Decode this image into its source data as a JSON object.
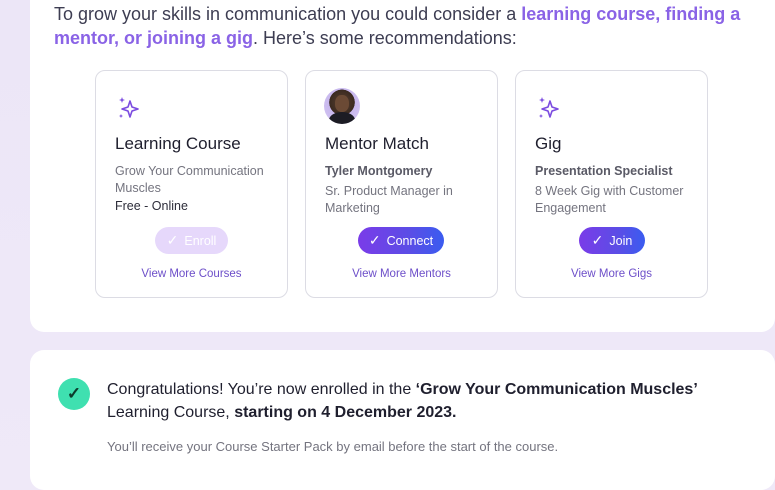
{
  "intro": {
    "text_before": "To grow your skills in communication you could consider a ",
    "highlight": "learning course, finding a mentor, or joining a gig",
    "text_after": ". Here’s some recommendations:"
  },
  "cards": [
    {
      "icon": "sparkle-icon",
      "title": "Learning Course",
      "subtitle": "Grow Your Communication Muscles",
      "detail": "Free - Online",
      "button_label": "Enroll",
      "button_state": "disabled",
      "link": "View More Courses"
    },
    {
      "icon": "avatar",
      "title": "Mentor Match",
      "subtitle": "Tyler Montgomery",
      "detail": "Sr. Product Manager in Marketing",
      "button_label": "Connect",
      "link": "View More Mentors"
    },
    {
      "icon": "sparkle-icon",
      "title": "Gig",
      "subtitle": "Presentation Specialist",
      "detail": "8 Week Gig with Customer Engagement",
      "button_label": "Join",
      "link": "View More Gigs"
    }
  ],
  "confirmation": {
    "line_before": "Congratulations! You’re now enrolled in the ",
    "course_name": "‘Grow Your Communication Muscles’",
    "line_middle": " Learning Course, ",
    "start_text": "starting on 4 December 2023.",
    "note": "You’ll receive your Course Starter Pack by email before the start of the course."
  },
  "colors": {
    "accent": "#8a63e6",
    "button_gradient_start": "#7a3ce8",
    "button_gradient_end": "#3a5cf0",
    "success": "#3fe0b0"
  }
}
